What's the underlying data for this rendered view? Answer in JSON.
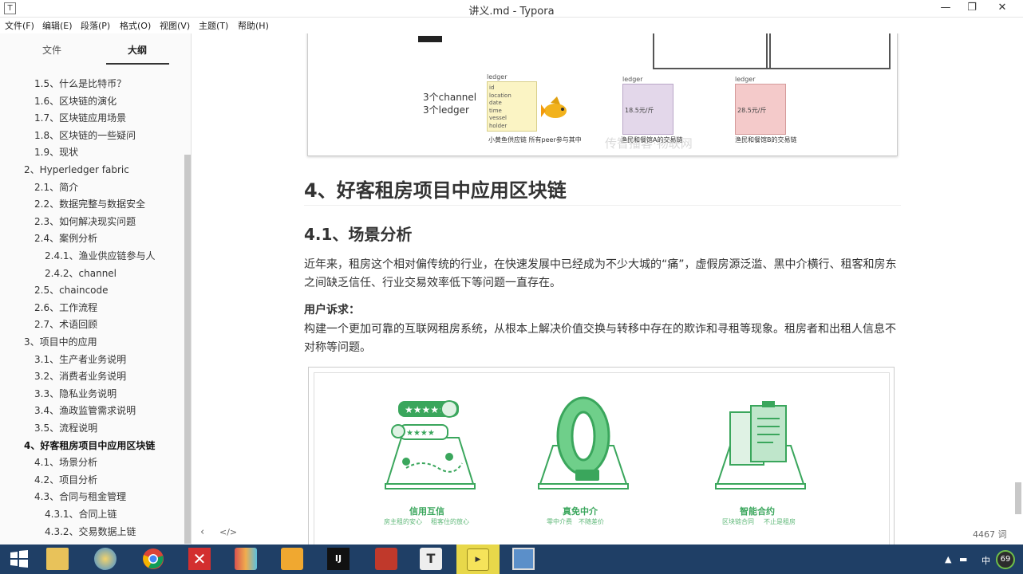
{
  "window": {
    "title": "讲义.md - Typora"
  },
  "menu": [
    "文件(F)",
    "编辑(E)",
    "段落(P)",
    "格式(O)",
    "视图(V)",
    "主题(T)",
    "帮助(H)"
  ],
  "sidebar": {
    "tabs": [
      "文件",
      "大纲"
    ],
    "outline": [
      {
        "label": "1.5、什么是比特币？",
        "indent": 1
      },
      {
        "label": "1.6、区块链的演化",
        "indent": 1
      },
      {
        "label": "1.7、区块链应用场景",
        "indent": 1
      },
      {
        "label": "1.8、区块链的一些疑问",
        "indent": 1
      },
      {
        "label": "1.9、现状",
        "indent": 1
      },
      {
        "label": "2、Hyperledger fabric",
        "indent": 0
      },
      {
        "label": "2.1、简介",
        "indent": 1
      },
      {
        "label": "2.2、数据完整与数据安全",
        "indent": 1
      },
      {
        "label": "2.3、如何解决现实问题",
        "indent": 1
      },
      {
        "label": "2.4、案例分析",
        "indent": 1
      },
      {
        "label": "2.4.1、渔业供应链参与人",
        "indent": 2
      },
      {
        "label": "2.4.2、channel",
        "indent": 2
      },
      {
        "label": "2.5、chaincode",
        "indent": 1
      },
      {
        "label": "2.6、工作流程",
        "indent": 1
      },
      {
        "label": "2.7、术语回顾",
        "indent": 1
      },
      {
        "label": "3、项目中的应用",
        "indent": 0
      },
      {
        "label": "3.1、生产者业务说明",
        "indent": 1
      },
      {
        "label": "3.2、消费者业务说明",
        "indent": 1
      },
      {
        "label": "3.3、隐私业务说明",
        "indent": 1
      },
      {
        "label": "3.4、渔政监管需求说明",
        "indent": 1
      },
      {
        "label": "3.5、流程说明",
        "indent": 1
      },
      {
        "label": "4、好客租房项目中应用区块链",
        "indent": 0,
        "bold": true
      },
      {
        "label": "4.1、场景分析",
        "indent": 1
      },
      {
        "label": "4.2、项目分析",
        "indent": 1
      },
      {
        "label": "4.3、合同与租金管理",
        "indent": 1
      },
      {
        "label": "4.3.1、合同上链",
        "indent": 2
      },
      {
        "label": "4.3.2、交易数据上链",
        "indent": 2
      }
    ]
  },
  "image1": {
    "channel_text": "3个channel",
    "ledger_text": "3个ledger",
    "ledger_label": "ledger",
    "fields": [
      "id",
      "location",
      "date",
      "time",
      "vessel",
      "holder"
    ],
    "caption1": "小黄鱼供应链 所有peer参与其中",
    "price_a": "18.5元/斤",
    "caption2": "渔民和餐馆A的交易链",
    "price_b": "28.5元/斤",
    "caption3": "渔民和餐馆B的交易链",
    "watermark": "传智播客·物联网"
  },
  "doc": {
    "h1": "4、好客租房项目中应用区块链",
    "h2": "4.1、场景分析",
    "p1": "近年来，租房这个相对偏传统的行业，在快速发展中已经成为不少大城的“痛”，虚假房源泛滥、黑中介横行、租客和房东之间缺乏信任、行业交易效率低下等问题一直存在。",
    "strong": "用户诉求：",
    "p2": "构建一个更加可靠的互联网租房系统，从根本上解决价值交换与转移中存在的欺诈和寻租等现象。租房者和出租人信息不对称等问题。"
  },
  "image2": {
    "features": [
      {
        "title": "信用互信",
        "sub1": "房主租的安心",
        "sub2": "租客住的放心"
      },
      {
        "title": "真免中介",
        "sub1": "零中介费",
        "sub2": "不随差价"
      },
      {
        "title": "智能合约",
        "sub1": "区块链合同",
        "sub2": "不止是租房"
      }
    ],
    "zero_char": "0"
  },
  "status": {
    "word_count": "4467 词"
  },
  "tray": {
    "ime": "中",
    "badge": "69"
  }
}
